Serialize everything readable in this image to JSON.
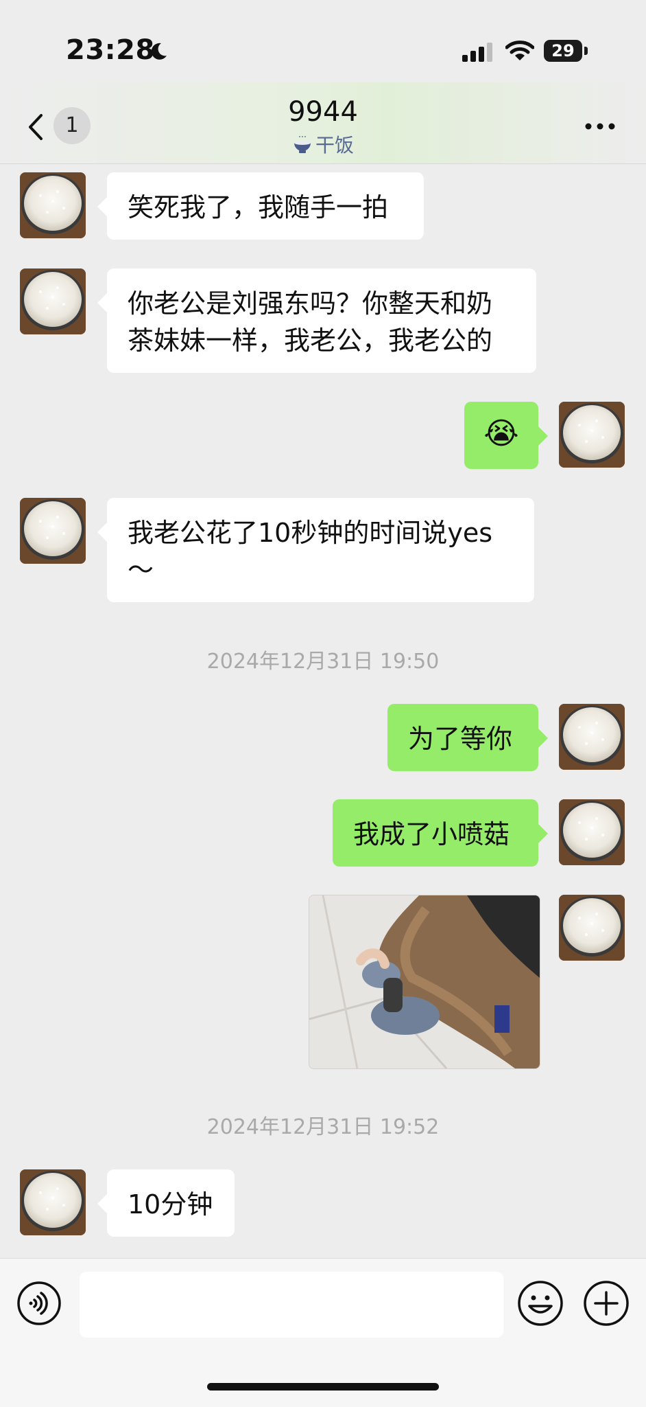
{
  "status_bar": {
    "time": "23:28",
    "battery": "29"
  },
  "nav": {
    "unread_count": "1",
    "title": "9944",
    "subtitle": "干饭"
  },
  "messages": [
    {
      "side": "in",
      "text": "笑死我了，我随手一拍"
    },
    {
      "side": "in",
      "text": "你老公是刘强东吗？你整天和奶\n茶妹妹一样，我老公，我老公的"
    },
    {
      "side": "out",
      "text": "😭"
    },
    {
      "side": "in",
      "text": "我老公花了10秒钟的时间说yes\n～"
    },
    {
      "side": "out",
      "text": "为了等你"
    },
    {
      "side": "out",
      "text": "我成了小喷菇"
    },
    {
      "side": "in",
      "text": "10分钟"
    }
  ],
  "timestamps": [
    "2024年12月31日 19:50",
    "2024年12月31日 19:52"
  ],
  "input": {
    "placeholder": ""
  },
  "colors": {
    "background": "#ededed",
    "outgoing_bubble": "#95ec69",
    "incoming_bubble": "#ffffff",
    "subtitle": "#576b95"
  }
}
